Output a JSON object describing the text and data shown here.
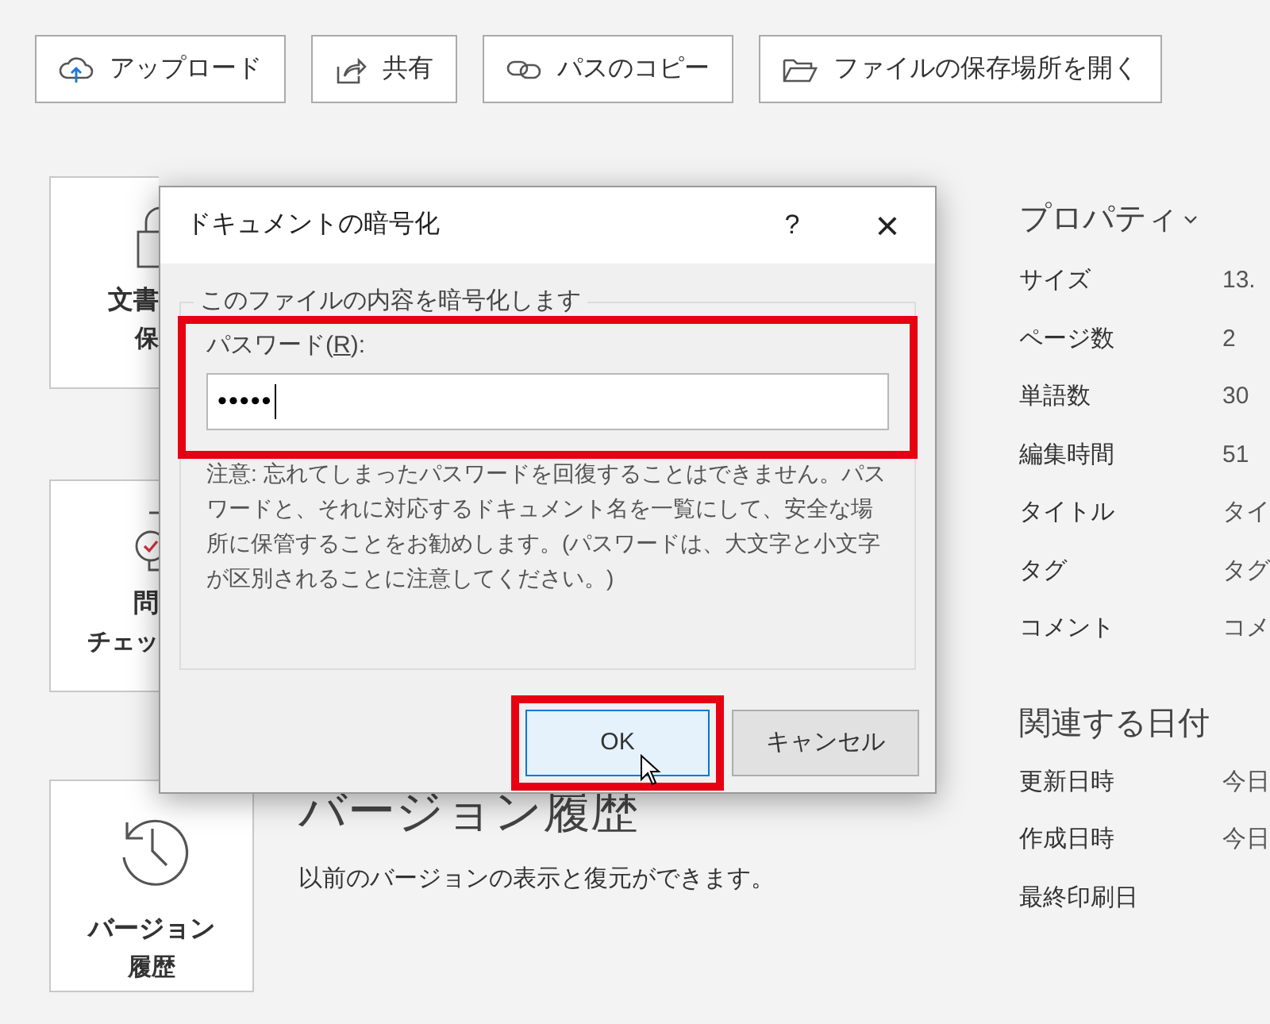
{
  "toolbar": [
    {
      "kind": "upload",
      "label": "アップロード"
    },
    {
      "kind": "share",
      "label": "共有"
    },
    {
      "kind": "link",
      "label": "パスのコピー"
    },
    {
      "kind": "folder",
      "label": "ファイルの保存場所を開く"
    }
  ],
  "tiles": [
    {
      "kind": "lock",
      "lines": [
        "文書",
        "保"
      ]
    },
    {
      "kind": "check",
      "lines": [
        "問",
        "チェッ"
      ]
    },
    {
      "kind": "history",
      "lines": [
        "バージョン",
        "履歴"
      ],
      "heading": "バージョン履歴",
      "description": "以前のバージョンの表示と復元ができます。"
    }
  ],
  "properties": {
    "title": "プロパティ",
    "rows": [
      {
        "label": "サイズ",
        "value": "13."
      },
      {
        "label": "ページ数",
        "value": "2"
      },
      {
        "label": "単語数",
        "value": "30"
      },
      {
        "label": "編集時間",
        "value": "51"
      },
      {
        "label": "タイトル",
        "value": "タイ"
      },
      {
        "label": "タグ",
        "value": "タグ"
      },
      {
        "label": "コメント",
        "value": "コメ"
      }
    ]
  },
  "dates": {
    "title": "関連する日付",
    "rows": [
      {
        "label": "更新日時",
        "value": "今日"
      },
      {
        "label": "作成日時",
        "value": "今日"
      },
      {
        "label": "最終印刷日"
      }
    ]
  },
  "dialog": {
    "title": "ドキュメントの暗号化",
    "help": "?",
    "close": "×",
    "group": "このファイルの内容を暗号化します",
    "password_label": {
      "before": "パスワード(",
      "key": "R",
      "after": "):"
    },
    "password_value": "•••••",
    "note": "注意: 忘れてしまったパスワードを回復することはできません。パスワードと、それに対応するドキュメント名を一覧にして、安全な場所に保管することをお勧めします。(パスワードは、大文字と小文字が区別されることに注意してください。)",
    "buttons": [
      {
        "label": "OK",
        "default": true
      },
      {
        "label": "キャンセル",
        "default": false
      }
    ]
  }
}
